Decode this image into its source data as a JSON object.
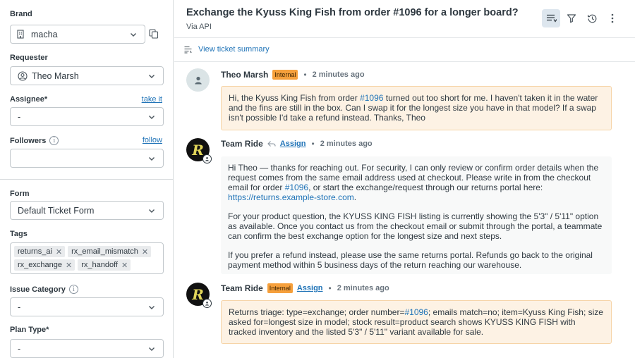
{
  "sidebar": {
    "brand": {
      "label": "Brand",
      "value": "macha"
    },
    "requester": {
      "label": "Requester",
      "value": "Theo Marsh"
    },
    "assignee": {
      "label": "Assignee*",
      "action": "take it",
      "value": "-"
    },
    "followers": {
      "label": "Followers",
      "action": "follow",
      "value": ""
    },
    "form": {
      "label": "Form",
      "value": "Default Ticket Form"
    },
    "tags": {
      "label": "Tags",
      "items": [
        "returns_ai",
        "rx_email_mismatch",
        "rx_exchange",
        "rx_handoff"
      ]
    },
    "issue_category": {
      "label": "Issue Category",
      "value": "-"
    },
    "plan_type": {
      "label": "Plan Type*",
      "value": "-"
    }
  },
  "ticket": {
    "title": "Exchange the Kyuss King Fish from order #1096 for a longer board?",
    "via": "Via API",
    "summary_link": "View ticket summary"
  },
  "messages": [
    {
      "author": "Theo Marsh",
      "badge": "Internal",
      "time": "2 minutes ago",
      "paragraphs": [
        [
          "Hi, the Kyuss King Fish from order ",
          {
            "link": "#1096"
          },
          " turned out too short for me. I haven't taken it in the water and the fins are still in the box. Can I swap it for the longest size you have in that model? If a swap isn't possible I'd take a refund instead. Thanks, Theo"
        ]
      ]
    },
    {
      "author": "Team Ride",
      "assign": "Assign",
      "time": "2 minutes ago",
      "paragraphs": [
        [
          "Hi Theo — thanks for reaching out. For security, I can only review or confirm order details when the request comes from the same email address used at checkout. Please write in from the checkout email for order ",
          {
            "link": "#1096"
          },
          ", or start the exchange/request through our returns portal here: ",
          {
            "link": "https://returns.example-store.com"
          },
          "."
        ],
        [
          "For your product question, the KYUSS KING FISH listing is currently showing the 5'3\" / 5'11\" option as available. Once you contact us from the checkout email or submit through the portal, a teammate can confirm the best exchange option for the longest size and next steps."
        ],
        [
          "If you prefer a refund instead, please use the same returns portal. Refunds go back to the original payment method within 5 business days of the return reaching our warehouse."
        ]
      ]
    },
    {
      "author": "Team Ride",
      "badge": "Internal",
      "assign": "Assign",
      "time": "2 minutes ago",
      "paragraphs": [
        [
          "Returns triage: type=exchange; order number=",
          {
            "link": "#1096"
          },
          "; emails match=no; item=Kyuss King Fish; size asked for=longest size in model; stock result=product search shows KYUSS KING FISH with tracked inventory and the listed 5'3\" / 5'11\" variant available for sale."
        ]
      ]
    }
  ],
  "colors": {
    "accent": "#1f73b7",
    "internal_badge": "#f6a03c",
    "internal_bg": "#fdf2e4"
  }
}
